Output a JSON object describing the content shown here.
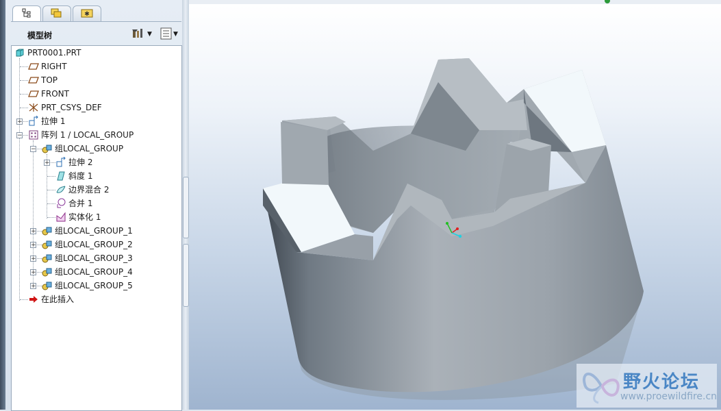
{
  "navigator": {
    "title": "模型树",
    "tabs": [
      "model-tree-tab",
      "folder-browser-tab",
      "favorites-tab"
    ]
  },
  "tree": {
    "root": "PRT0001.PRT",
    "items": [
      {
        "label": "RIGHT",
        "icon": "datum-plane-icon"
      },
      {
        "label": "TOP",
        "icon": "datum-plane-icon"
      },
      {
        "label": "FRONT",
        "icon": "datum-plane-icon"
      },
      {
        "label": "PRT_CSYS_DEF",
        "icon": "coordinate-system-icon"
      },
      {
        "label": "拉伸 1",
        "icon": "extrude-icon"
      },
      {
        "label": "阵列 1 / LOCAL_GROUP",
        "icon": "pattern-icon"
      },
      {
        "label": "组LOCAL_GROUP",
        "icon": "group-icon"
      },
      {
        "label": "拉伸 2",
        "icon": "extrude-icon"
      },
      {
        "label": "斜度 1",
        "icon": "draft-icon"
      },
      {
        "label": "边界混合 2",
        "icon": "boundary-blend-icon"
      },
      {
        "label": "合并 1",
        "icon": "merge-icon"
      },
      {
        "label": "实体化 1",
        "icon": "solidify-icon"
      },
      {
        "label": "组LOCAL_GROUP_1",
        "icon": "group-icon"
      },
      {
        "label": "组LOCAL_GROUP_2",
        "icon": "group-icon"
      },
      {
        "label": "组LOCAL_GROUP_3",
        "icon": "group-icon"
      },
      {
        "label": "组LOCAL_GROUP_4",
        "icon": "group-icon"
      },
      {
        "label": "组LOCAL_GROUP_5",
        "icon": "group-icon"
      },
      {
        "label": "在此插入",
        "icon": "insert-here-arrow-icon"
      }
    ]
  },
  "watermark": {
    "title": "野火论坛",
    "url": "www.proewildfire.cn"
  },
  "colors": {
    "part_face_light": "#f2f8fb",
    "part_body": "#9aa2aa",
    "background_top": "#ffffff",
    "background_bottom": "#9fb4cf",
    "watermark_blue": "#4a86c5"
  }
}
